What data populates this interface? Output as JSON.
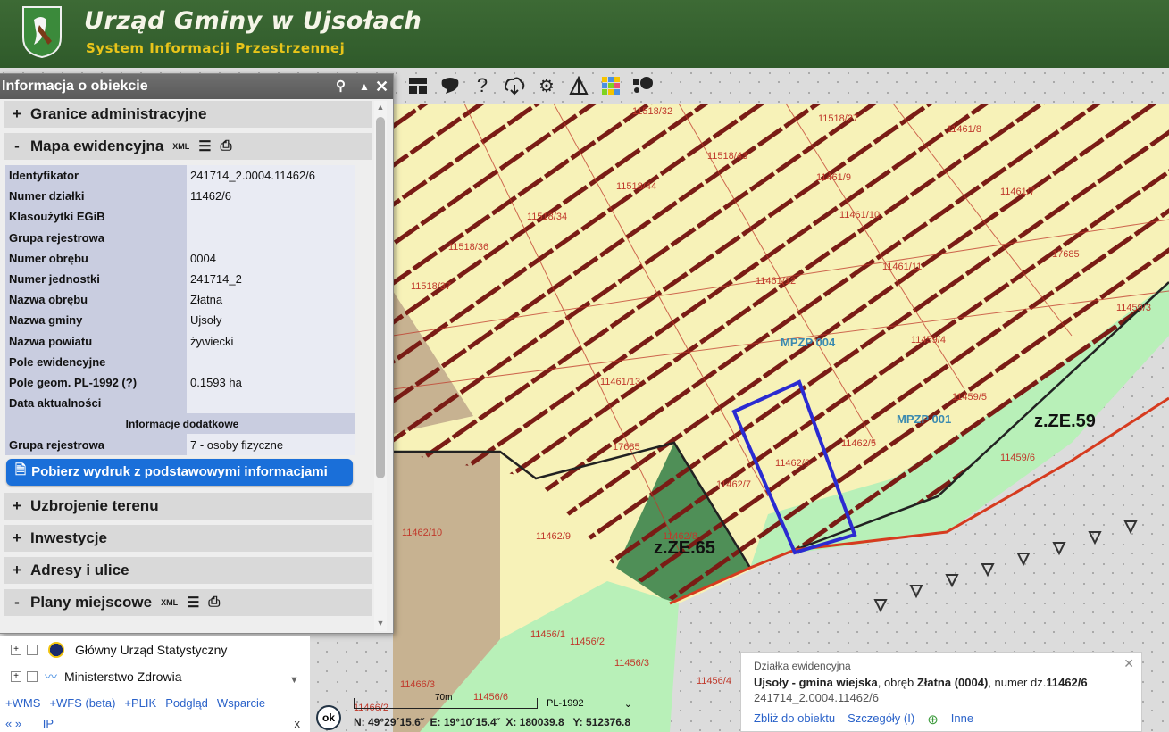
{
  "header": {
    "title": "Urząd Gminy w Ujsołach",
    "subtitle": "System Informacji Przestrzennej"
  },
  "toolbar": {
    "icons": [
      "layout-icon",
      "speech-bubble-icon",
      "help-icon",
      "cloud-download-icon",
      "settings-icon",
      "measure-icon",
      "color-grid-icon",
      "comment-icon"
    ]
  },
  "panel": {
    "title": "Informacja o obiekcie",
    "sections": {
      "granice": "Granice administracyjne",
      "mapa": "Mapa ewidencyjna",
      "uzbrojenie": "Uzbrojenie terenu",
      "inwestycje": "Inwestycje",
      "adresy": "Adresy i ulice",
      "plany": "Plany miejscowe"
    },
    "xml_label": "XML",
    "attributes": [
      {
        "k": "Identyfikator",
        "v": "241714_2.0004.11462/6"
      },
      {
        "k": "Numer działki",
        "v": "11462/6"
      },
      {
        "k": "Klasoużytki EGiB",
        "v": ""
      },
      {
        "k": "Grupa rejestrowa",
        "v": ""
      },
      {
        "k": "Numer obrębu",
        "v": "0004"
      },
      {
        "k": "Numer jednostki",
        "v": "241714_2"
      },
      {
        "k": "Nazwa obrębu",
        "v": "Złatna"
      },
      {
        "k": "Nazwa gminy",
        "v": "Ujsoły"
      },
      {
        "k": "Nazwa powiatu",
        "v": "żywiecki"
      },
      {
        "k": "Pole ewidencyjne",
        "v": ""
      },
      {
        "k": "Pole geom. PL-1992 (?)",
        "v": "0.1593 ha"
      },
      {
        "k": "Data aktualności",
        "v": ""
      }
    ],
    "extra_header": "Informacje dodatkowe",
    "extra": [
      {
        "k": "Grupa rejestrowa",
        "v": "7 - osoby fizyczne"
      }
    ],
    "print_button": "Pobierz wydruk z podstawowymi informacjami"
  },
  "layers": {
    "rows": [
      {
        "label": "Główny Urząd Statystyczny"
      },
      {
        "label": "Ministerstwo Zdrowia"
      }
    ],
    "links": [
      "+WMS",
      "+WFS (beta)",
      "+PLIK",
      "Podgląd",
      "Wsparcie"
    ],
    "nav": {
      "left": "« »",
      "ip": "IP",
      "close": "x"
    }
  },
  "coords": {
    "scale": "70m",
    "crs": "PL-1992",
    "ok": "ok",
    "readout": "N: 49°29´15.6˝  E: 19°10´15.4˝  X: 180039.8   Y: 512376.8"
  },
  "popup": {
    "title": "Działka ewidencyjna",
    "desc_a": "Ujsoły - gmina wiejska",
    "desc_b": ", obręb ",
    "desc_c": "Złatna (0004)",
    "desc_d": ", numer dz.",
    "desc_e": "11462/6",
    "id": "241714_2.0004.11462/6",
    "link_zoom": "Zbliż do obiektu",
    "link_details": "Szczegóły (I)",
    "link_other": "Inne"
  },
  "map": {
    "labels": [
      "11518/32",
      "11518/27",
      "11461/8",
      "11518/43",
      "11518/44",
      "11461/9",
      "11461/7",
      "11518/34",
      "11461/10",
      "11518/36",
      "17685",
      "11461/11",
      "11518/37",
      "11461/12",
      "11459/3",
      "MPZP 004",
      "11459/4",
      "11461/13",
      "11459/5",
      "MPZP 001",
      "z.ZE.59",
      "17685",
      "11462/5",
      "11459/6",
      "11462/6",
      "11462/7",
      "11462/8",
      "z.ZE.65",
      "11462/10",
      "11462/9",
      "11456/1",
      "11456/2",
      "11456/3",
      "11466/3",
      "11456/6",
      "11456/4",
      "11466/2"
    ]
  },
  "colors": {
    "header": "#35612f",
    "hdr_sub": "#e8c41a",
    "parcel_outline": "#2b2bd1",
    "hatch": "#7a1c15",
    "zone_green": "#4f8f57",
    "zone_lightgreen": "#b8f0b8",
    "parcel_fill": "#f7f2b8"
  }
}
